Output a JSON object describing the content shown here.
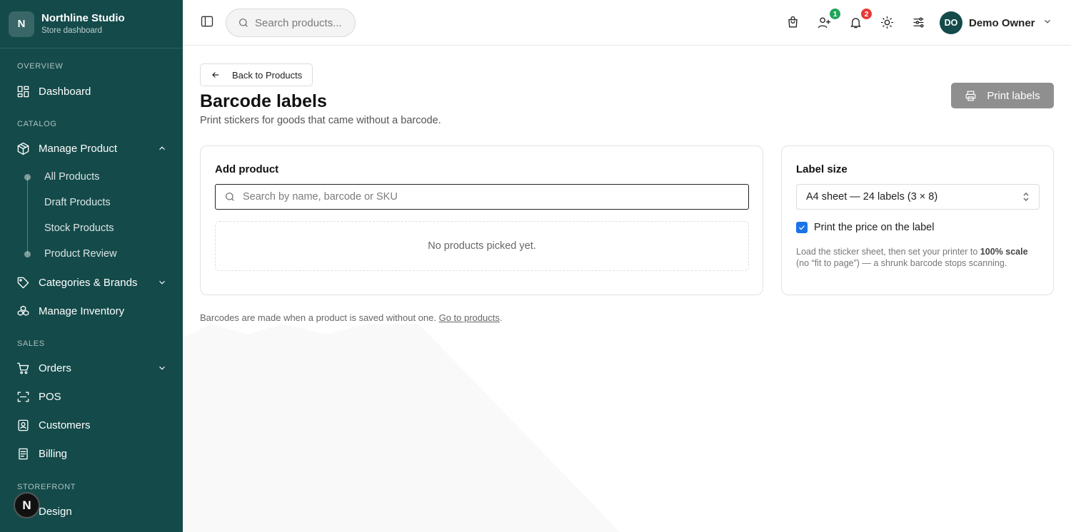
{
  "sidebar": {
    "brand_initial": "N",
    "brand_name": "Northline Studio",
    "brand_sub": "Store dashboard",
    "sections": {
      "overview": "OVERVIEW",
      "catalog": "CATALOG",
      "sales": "SALES",
      "storefront": "STOREFRONT"
    },
    "items": {
      "dashboard": "Dashboard",
      "manage_product": "Manage Product",
      "categories_brands": "Categories & Brands",
      "manage_inventory": "Manage Inventory",
      "orders": "Orders",
      "pos": "POS",
      "customers": "Customers",
      "billing": "Billing",
      "design": "Design"
    },
    "sub_items": {
      "all_products": "All Products",
      "draft_products": "Draft Products",
      "stock_products": "Stock Products",
      "product_review": "Product Review"
    },
    "floating_initial": "N",
    "bg_color": "#144a4a"
  },
  "topbar": {
    "search_placeholder": "Search products...",
    "badges": {
      "users": "1",
      "notifications": "2"
    },
    "badge_colors": {
      "users": "#22a35a",
      "notifications": "#e53935"
    },
    "user_initials": "DO",
    "user_name": "Demo Owner"
  },
  "main": {
    "back_label": "Back to Products",
    "title": "Barcode labels",
    "subtitle": "Print stickers for goods that came without a barcode.",
    "print_label": "Print labels",
    "add_product": {
      "title": "Add product",
      "search_placeholder": "Search by name, barcode or SKU",
      "empty_text": "No products picked yet."
    },
    "label_size": {
      "title": "Label size",
      "selected": "A4 sheet — 24 labels (3 × 8)",
      "print_price_label": "Print the price on the label",
      "print_price_checked": true,
      "hint_pre": "Load the sticker sheet, then set your printer to ",
      "hint_bold": "100% scale",
      "hint_post": " (no “fit to page”) — a shrunk barcode stops scanning."
    },
    "footer_text": "Barcodes are made when a product is saved without one. ",
    "footer_link": "Go to products",
    "footer_end": "."
  }
}
